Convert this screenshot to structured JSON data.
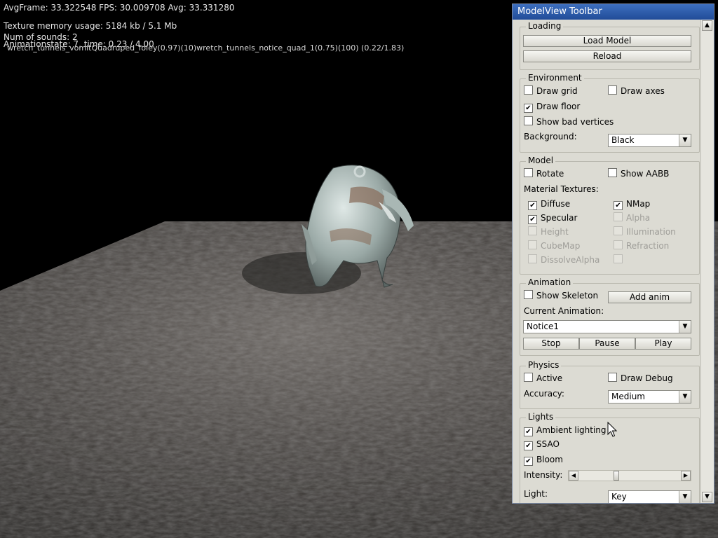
{
  "hud": {
    "fps_line": "AvgFrame: 33.322548  FPS: 30.009708 Avg: 33.331280",
    "texture_line": "Texture memory usage: 5184 kb / 5.1 Mb",
    "sounds_line": "Num of sounds: 2",
    "anim_line": "Animationstate: 7, time: 0.23 / 4.00",
    "sound_overlay": "wretch_tunnels_vomitQuadruped_foley(0.97)(10)wretch_tunnels_notice_quad_1(0.75)(100) (0.22/1.83)"
  },
  "toolbar": {
    "title": "ModelView Toolbar",
    "loading": {
      "label": "Loading",
      "load_model": "Load Model",
      "reload": "Reload"
    },
    "environment": {
      "label": "Environment",
      "draw_grid": {
        "label": "Draw grid",
        "checked": false
      },
      "draw_axes": {
        "label": "Draw axes",
        "checked": false
      },
      "draw_floor": {
        "label": "Draw floor",
        "checked": true
      },
      "show_bad_vertices": {
        "label": "Show bad vertices",
        "checked": false
      },
      "background_label": "Background:",
      "background_value": "Black"
    },
    "model": {
      "label": "Model",
      "rotate": {
        "label": "Rotate",
        "checked": false
      },
      "show_aabb": {
        "label": "Show AABB",
        "checked": false
      },
      "material_textures_label": "Material Textures:",
      "textures": [
        {
          "label": "Diffuse",
          "checked": true,
          "enabled": true
        },
        {
          "label": "NMap",
          "checked": true,
          "enabled": true
        },
        {
          "label": "Specular",
          "checked": true,
          "enabled": true
        },
        {
          "label": "Alpha",
          "checked": false,
          "enabled": false
        },
        {
          "label": "Height",
          "checked": false,
          "enabled": false
        },
        {
          "label": "Illumination",
          "checked": false,
          "enabled": false
        },
        {
          "label": "CubeMap",
          "checked": false,
          "enabled": false
        },
        {
          "label": "Refraction",
          "checked": false,
          "enabled": false
        },
        {
          "label": "DissolveAlpha",
          "checked": false,
          "enabled": false
        },
        {
          "label": "",
          "checked": false,
          "enabled": false
        }
      ]
    },
    "animation": {
      "label": "Animation",
      "show_skeleton": {
        "label": "Show Skeleton",
        "checked": false
      },
      "add_anim": "Add anim",
      "current_label": "Current Animation:",
      "current_value": "Notice1",
      "stop": "Stop",
      "pause": "Pause",
      "play": "Play"
    },
    "physics": {
      "label": "Physics",
      "active": {
        "label": "Active",
        "checked": false
      },
      "draw_debug": {
        "label": "Draw Debug",
        "checked": false
      },
      "accuracy_label": "Accuracy:",
      "accuracy_value": "Medium"
    },
    "lights": {
      "label": "Lights",
      "ambient": {
        "label": "Ambient lighting",
        "checked": true
      },
      "ssao": {
        "label": "SSAO",
        "checked": true
      },
      "bloom": {
        "label": "Bloom",
        "checked": true
      },
      "intensity_label": "Intensity:",
      "intensity_value": 0.36,
      "light_label": "Light:",
      "light_value": "Key"
    }
  },
  "icons": {
    "check": "✔",
    "dropdown": "▼",
    "arrow_left": "◀",
    "arrow_right": "▶",
    "arrow_up": "▲",
    "arrow_down": "▼"
  }
}
